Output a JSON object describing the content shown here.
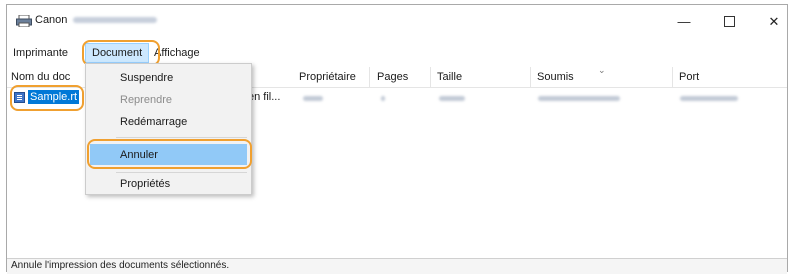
{
  "window": {
    "title_prefix": "Canon",
    "controls": {
      "minimize": "—",
      "close": "✕"
    }
  },
  "menubar": {
    "items": [
      "Imprimante",
      "Document",
      "Affichage"
    ]
  },
  "columns": [
    "Nom du doc",
    "Propriétaire",
    "Pages",
    "Taille",
    "Soumis",
    "Port"
  ],
  "rows": [
    {
      "name": "Sample.rt",
      "status_partial": "en fil..."
    }
  ],
  "document_menu": {
    "items": [
      {
        "label": "Suspendre",
        "enabled": true
      },
      {
        "label": "Reprendre",
        "enabled": false
      },
      {
        "label": "Redémarrage",
        "enabled": true
      },
      {
        "label": "Annuler",
        "enabled": true,
        "selected": true
      },
      {
        "label": "Propriétés",
        "enabled": true
      }
    ]
  },
  "statusbar": {
    "text": "Annule l'impression des documents sélectionnés."
  },
  "colors": {
    "highlight_outline": "#f0a030",
    "selection_blue": "#0078d7",
    "menu_hover": "#91c9f7"
  },
  "icons": [
    "printer-icon",
    "document-icon",
    "sort-arrow-icon",
    "minimize-icon",
    "maximize-icon",
    "close-icon"
  ]
}
